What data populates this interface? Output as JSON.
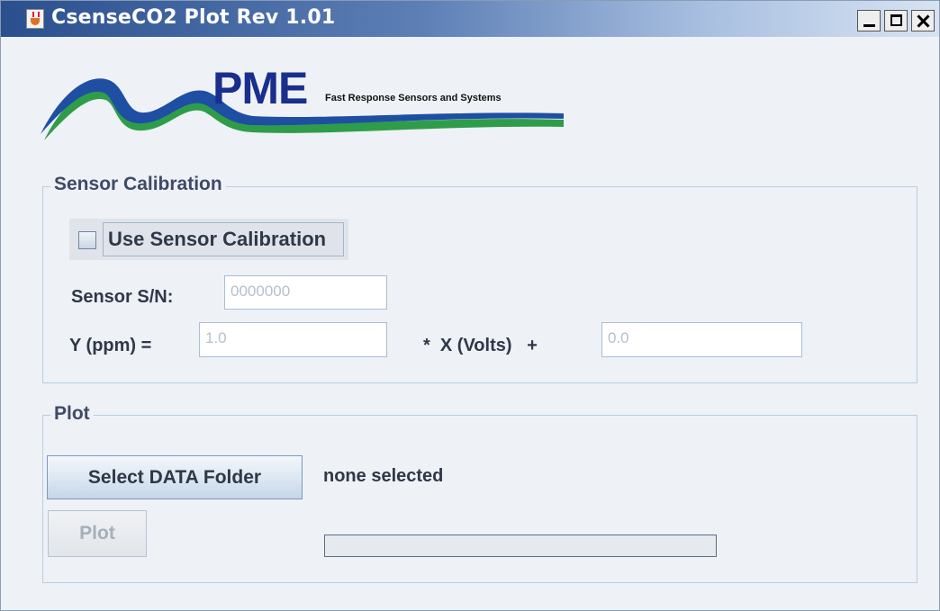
{
  "window": {
    "title": "CsenseCO2 Plot Rev 1.01",
    "controls": [
      "minimize-icon",
      "maximize-icon",
      "close-icon"
    ]
  },
  "logo": {
    "brand": "PME",
    "tagline": "Fast Response Sensors and Systems"
  },
  "sensor_calibration": {
    "title": "Sensor Calibration",
    "use_calibration_label": "Use Sensor Calibration",
    "use_calibration_checked": false,
    "serial_label": "Sensor S/N:",
    "serial_value": "0000000",
    "y_label": "Y (ppm) =",
    "slope_value": "1.0",
    "x_label": "*  X (Volts)   +",
    "offset_value": "0.0"
  },
  "plot": {
    "title": "Plot",
    "select_button_label": "Select DATA Folder",
    "folder_status": "none selected",
    "plot_button_label": "Plot",
    "progress": 0
  },
  "colors": {
    "accent": "#1a2e8c",
    "wave_dark": "#1e4fa3",
    "wave_green": "#2f9c4a",
    "group_border": "#b9cde4"
  }
}
